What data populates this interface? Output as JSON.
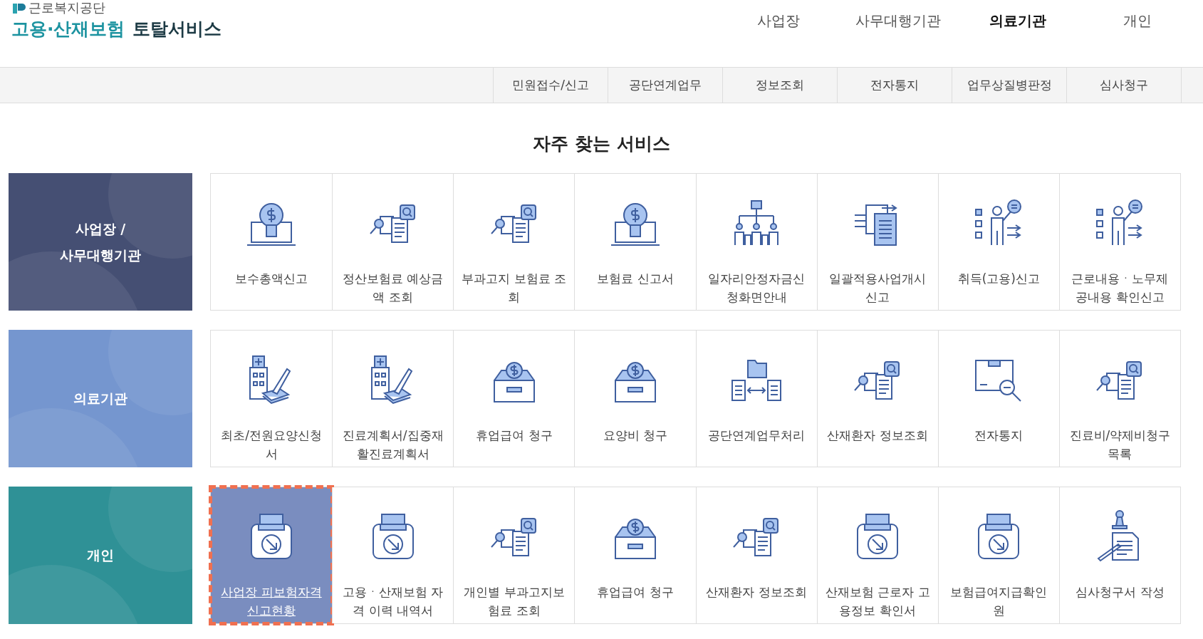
{
  "logo": {
    "org": "근로복지공단",
    "title_main": "고용·산재보험",
    "title_sub": "토탈서비스"
  },
  "top_nav": [
    {
      "label": "사업장",
      "selected": false
    },
    {
      "label": "사무대행기관",
      "selected": false
    },
    {
      "label": "의료기관",
      "selected": true
    },
    {
      "label": "개인",
      "selected": false
    }
  ],
  "sub_nav": [
    "민원접수/신고",
    "공단연계업무",
    "정보조회",
    "전자통지",
    "업무상질병판정",
    "심사청구"
  ],
  "section_title": "자주 찾는 서비스",
  "groups": [
    {
      "label": "사업장 /\n사무대행기관",
      "color": "#454f73",
      "services": [
        {
          "label": "보수총액신고",
          "kind": "bulb",
          "selected": false
        },
        {
          "label": "정산보험료 예상금액 조회",
          "kind": "docsearch",
          "selected": false
        },
        {
          "label": "부과고지 보험료 조회",
          "kind": "docsearch",
          "selected": false
        },
        {
          "label": "보험료 신고서",
          "kind": "bulb",
          "selected": false
        },
        {
          "label": "일자리안정자금신청화면안내",
          "kind": "org",
          "selected": false
        },
        {
          "label": "일괄적용사업개시신고",
          "kind": "docarrow",
          "selected": false
        },
        {
          "label": "취득(고용)신고",
          "kind": "person",
          "selected": false
        },
        {
          "label": "근로내용ㆍ노무제공내용 확인신고",
          "kind": "person",
          "selected": false
        }
      ]
    },
    {
      "label": "의료기관",
      "color": "#7596cf",
      "services": [
        {
          "label": "최초/전원요양신청서",
          "kind": "hospital",
          "selected": false
        },
        {
          "label": "진료계획서/집중재활진료계획서",
          "kind": "hospital",
          "selected": false
        },
        {
          "label": "휴업급여 청구",
          "kind": "coinbox",
          "selected": false
        },
        {
          "label": "요양비 청구",
          "kind": "coinbox",
          "selected": false
        },
        {
          "label": "공단연계업무처리",
          "kind": "exchange",
          "selected": false
        },
        {
          "label": "산재환자 정보조회",
          "kind": "docsearch",
          "selected": false
        },
        {
          "label": "전자통지",
          "kind": "boxsearch",
          "selected": false
        },
        {
          "label": "진료비/약제비청구목록",
          "kind": "docsearch",
          "selected": false
        }
      ]
    },
    {
      "label": "개인",
      "color": "#2f9196",
      "services": [
        {
          "label": "사업장 피보험자격신고현황",
          "kind": "printer",
          "selected": true
        },
        {
          "label": "고용ㆍ산재보험 자격 이력 내역서",
          "kind": "printer",
          "selected": false
        },
        {
          "label": "개인별 부과고지보험료 조회",
          "kind": "docsearch",
          "selected": false
        },
        {
          "label": "휴업급여 청구",
          "kind": "coinbox",
          "selected": false
        },
        {
          "label": "산재환자 정보조회",
          "kind": "docsearch",
          "selected": false
        },
        {
          "label": "산재보험 근로자 고용정보 확인서",
          "kind": "printer",
          "selected": false
        },
        {
          "label": "보험급여지급확인원",
          "kind": "printer",
          "selected": false
        },
        {
          "label": "심사청구서 작성",
          "kind": "stamp",
          "selected": false
        }
      ]
    }
  ]
}
